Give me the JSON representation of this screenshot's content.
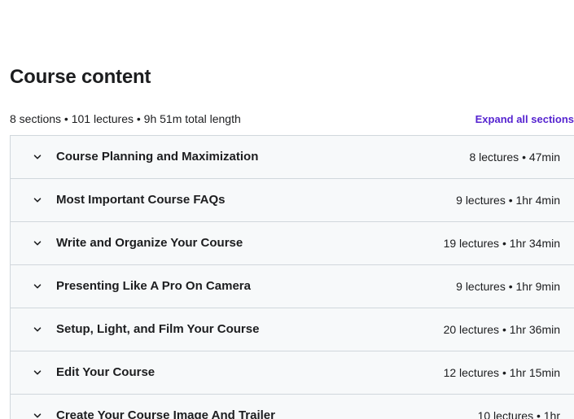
{
  "header": {
    "title": "Course content",
    "summary": "8 sections • 101 lectures • 9h 51m total length",
    "expand_all_label": "Expand all sections"
  },
  "colors": {
    "accent": "#5624d0",
    "section_bg": "#f7f9fa",
    "border": "#d1d7dc"
  },
  "sections": [
    {
      "title": "Course Planning and Maximization",
      "meta": "8 lectures • 47min"
    },
    {
      "title": "Most Important Course FAQs",
      "meta": "9 lectures • 1hr 4min"
    },
    {
      "title": "Write and Organize Your Course",
      "meta": "19 lectures • 1hr 34min"
    },
    {
      "title": "Presenting Like A Pro On Camera",
      "meta": "9 lectures • 1hr 9min"
    },
    {
      "title": "Setup, Light, and Film Your Course",
      "meta": "20 lectures • 1hr 36min"
    },
    {
      "title": "Edit Your Course",
      "meta": "12 lectures • 1hr 15min"
    },
    {
      "title": "Create Your Course Image And Trailer",
      "meta": "10 lectures • 1hr"
    }
  ]
}
